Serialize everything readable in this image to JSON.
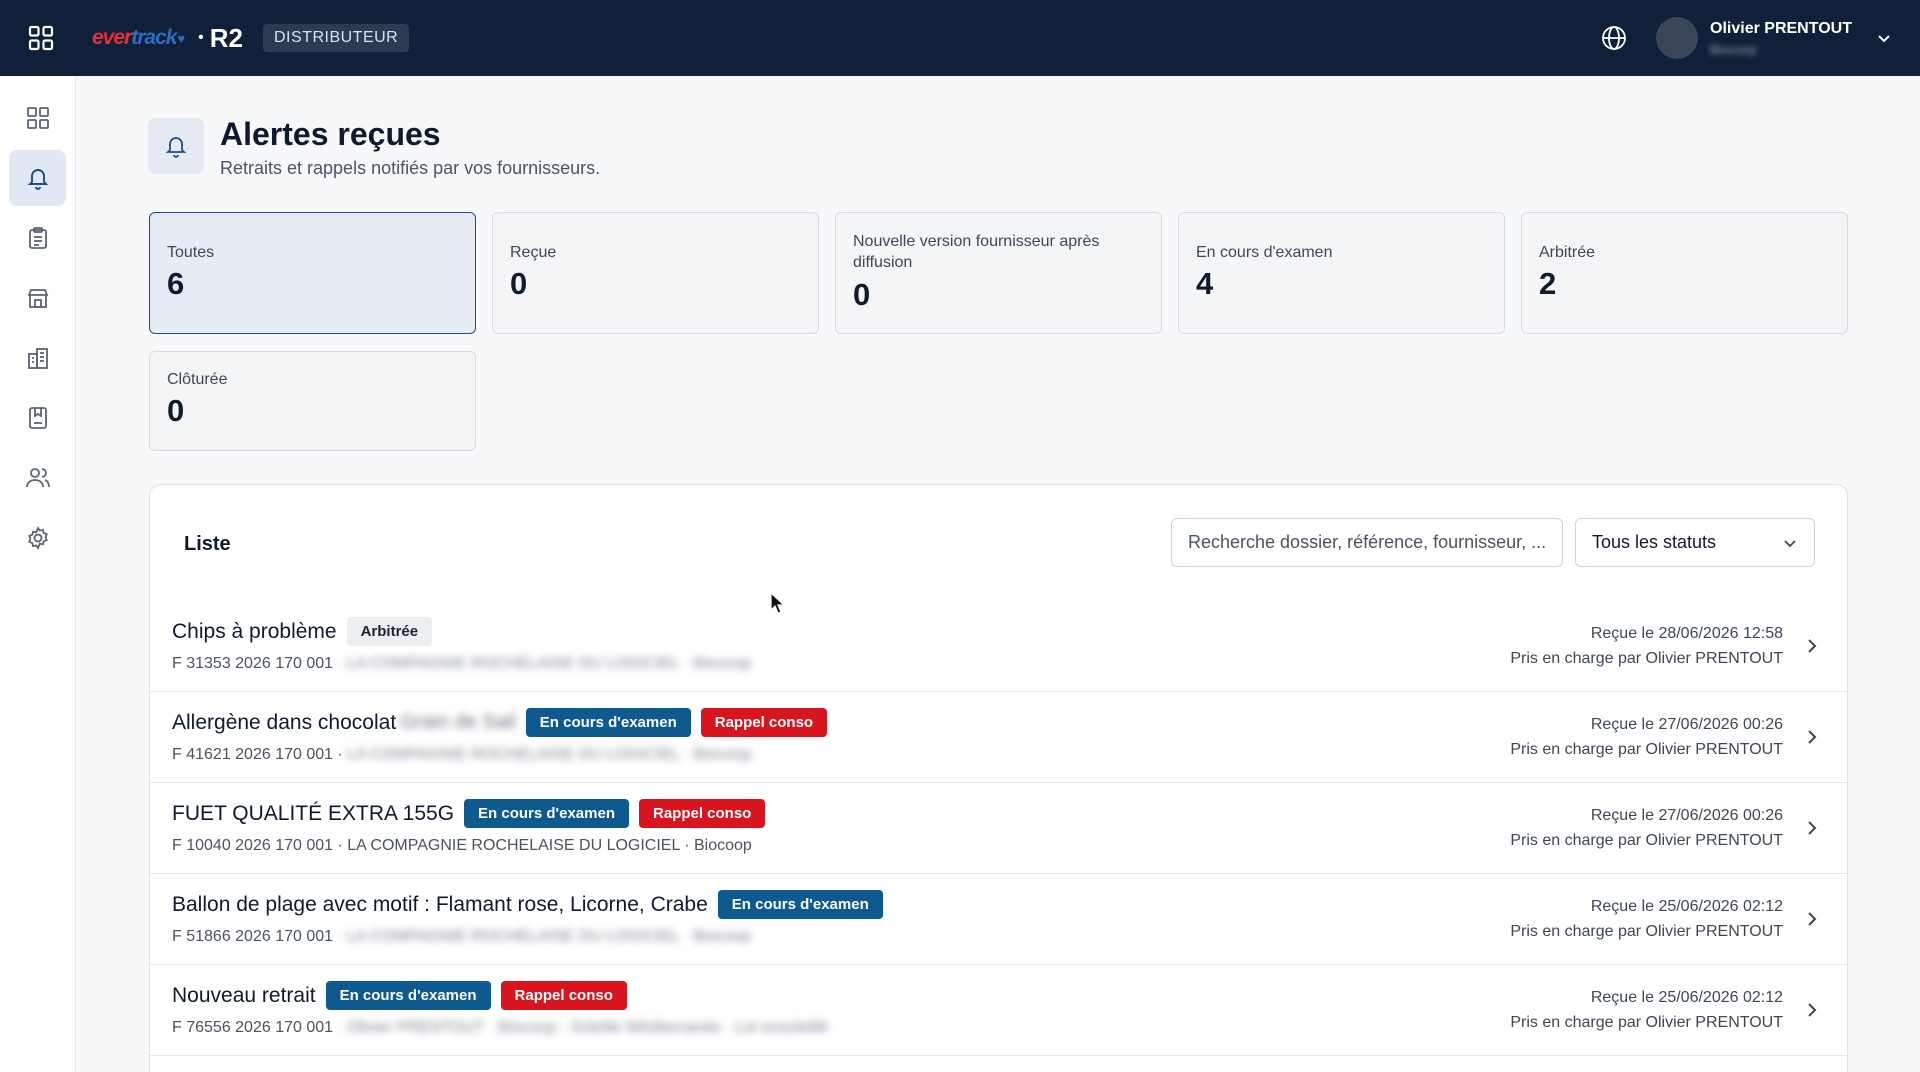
{
  "topbar": {
    "logo_part1": "ever",
    "logo_part2": "track",
    "logo_heart": "♥",
    "separator": "•",
    "product": "R2",
    "role": "DISTRIBUTEUR",
    "user_name": "Olivier PRENTOUT",
    "user_sub": "Biocoop",
    "icons": [
      "grid-icon",
      "globe-icon",
      "chevron-down-icon"
    ]
  },
  "sidebar": {
    "items": [
      {
        "name": "dashboard",
        "icon": "dashboard-icon",
        "active": false
      },
      {
        "name": "alerts",
        "icon": "bell-icon",
        "active": true
      },
      {
        "name": "clipboard",
        "icon": "clipboard-icon",
        "active": false
      },
      {
        "name": "store",
        "icon": "store-icon",
        "active": false
      },
      {
        "name": "building",
        "icon": "building-icon",
        "active": false
      },
      {
        "name": "book",
        "icon": "book-icon",
        "active": false
      },
      {
        "name": "users",
        "icon": "users-icon",
        "active": false
      },
      {
        "name": "settings",
        "icon": "gear-icon",
        "active": false
      }
    ]
  },
  "header": {
    "title": "Alertes reçues",
    "subtitle": "Retraits et rappels notifiés par vos fournisseurs."
  },
  "stats": [
    {
      "label": "Toutes",
      "value": "6",
      "active": true
    },
    {
      "label": "Reçue",
      "value": "0",
      "active": false
    },
    {
      "label": "Nouvelle version fournisseur après diffusion",
      "value": "0",
      "active": false
    },
    {
      "label": "En cours d'examen",
      "value": "4",
      "active": false
    },
    {
      "label": "Arbitrée",
      "value": "2",
      "active": false
    },
    {
      "label": "Clôturée",
      "value": "0",
      "active": false
    }
  ],
  "list": {
    "title": "Liste",
    "search_placeholder": "Recherche dossier, référence, fournisseur, ...",
    "status_filter": "Tous les statuts",
    "rows": [
      {
        "title": "Chips à problème",
        "title_blur": "",
        "badges": [
          {
            "text": "Arbitrée",
            "kind": "neutral"
          }
        ],
        "ref": "F 31353 2026 170 001",
        "details": "· LA COMPAGNIE ROCHELAISE DU LOGICIEL · Biocoop",
        "details_blurred": true,
        "date": "Reçue le 28/06/2026 12:58",
        "by": "Pris en charge par Olivier PRENTOUT"
      },
      {
        "title": "Allergène dans chocolat",
        "title_blur": "Grain de Sail",
        "badges": [
          {
            "text": "En cours d'examen",
            "kind": "blue"
          },
          {
            "text": "Rappel conso",
            "kind": "red"
          }
        ],
        "ref": "F 41621 2026 170 001 ·",
        "details": "LA COMPAGNIE ROCHELAISE DU LOGICIEL · Biocoop",
        "details_blurred": true,
        "date": "Reçue le 27/06/2026 00:26",
        "by": "Pris en charge par Olivier PRENTOUT"
      },
      {
        "title": "FUET QUALITÉ EXTRA 155G",
        "title_blur": "",
        "badges": [
          {
            "text": "En cours d'examen",
            "kind": "blue"
          },
          {
            "text": "Rappel conso",
            "kind": "red"
          }
        ],
        "ref": "F 10040 2026 170 001 · LA COMPAGNIE ROCHELAISE DU LOGICIEL · Biocoop",
        "details": "",
        "details_blurred": false,
        "date": "Reçue le 27/06/2026 00:26",
        "by": "Pris en charge par Olivier PRENTOUT"
      },
      {
        "title": "Ballon de plage avec motif : Flamant rose, Licorne, Crabe",
        "title_blur": "",
        "badges": [
          {
            "text": "En cours d'examen",
            "kind": "blue"
          }
        ],
        "ref": "F 51866 2026 170 001",
        "details": "· LA COMPAGNIE ROCHELAISE DU LOGICIEL · Biocoop",
        "details_blurred": true,
        "date": "Reçue le 25/06/2026 02:12",
        "by": "Pris en charge par Olivier PRENTOUT"
      },
      {
        "title": "Nouveau retrait",
        "title_blur": "",
        "badges": [
          {
            "text": "En cours d'examen",
            "kind": "blue"
          },
          {
            "text": "Rappel conso",
            "kind": "red"
          }
        ],
        "ref": "F 76556 2026 170 001",
        "details": "· Olivier PRENTOUT · Biocoop · Soleille Méditerranée · Lot ensoleillé",
        "details_blurred": true,
        "date": "Reçue le 25/06/2026 02:12",
        "by": "Pris en charge par Olivier PRENTOUT"
      }
    ]
  },
  "colors": {
    "topbar": "#0f2038",
    "accent": "#1f4e86",
    "badge_blue": "#0e5a8e",
    "badge_red": "#d8141f"
  }
}
